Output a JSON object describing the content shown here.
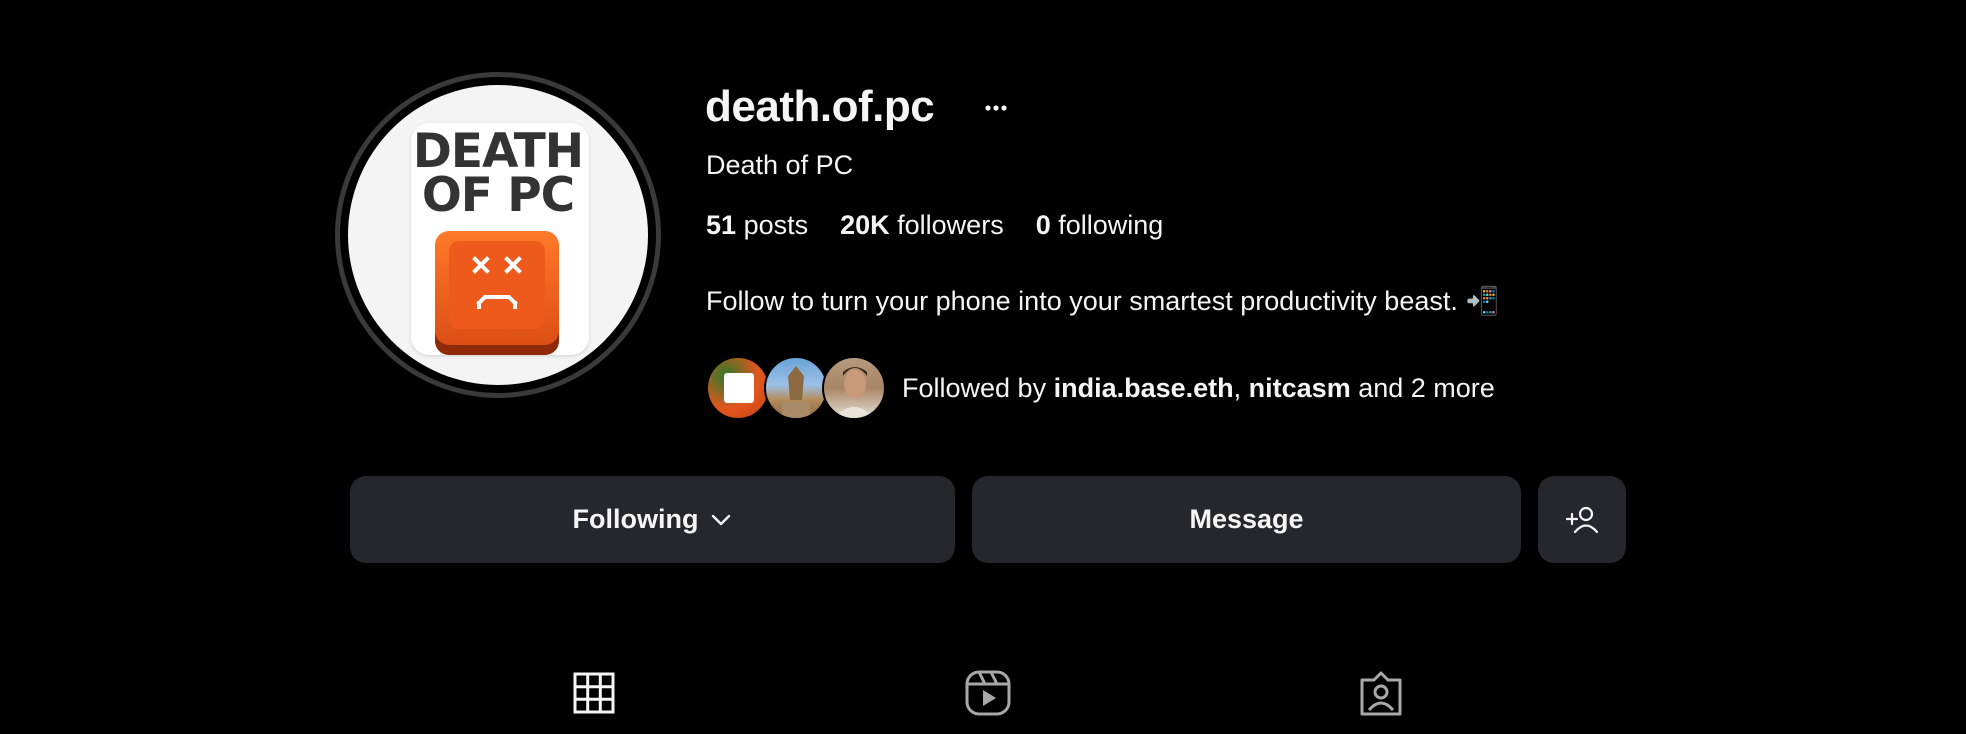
{
  "profile": {
    "username": "death.of.pc",
    "full_name": "Death of PC",
    "avatar_text": "DEATH OF PC",
    "stats": {
      "posts_count": "51",
      "posts_label": "posts",
      "followers_count": "20K",
      "followers_label": "followers",
      "following_count": "0",
      "following_label": "following"
    },
    "bio": "Follow to turn your phone into your smartest productivity beast.",
    "bio_emoji": "📲",
    "followed_by": {
      "prefix": "Followed by ",
      "user1": "india.base.eth",
      "separator": ", ",
      "user2": "nitcasm",
      "suffix": " and 2 more"
    }
  },
  "actions": {
    "following_label": "Following",
    "message_label": "Message",
    "add_user_icon": "add-user-icon"
  },
  "tabs": [
    {
      "name": "posts",
      "icon": "grid-icon"
    },
    {
      "name": "reels",
      "icon": "reels-icon"
    },
    {
      "name": "tagged",
      "icon": "tagged-icon"
    }
  ],
  "colors": {
    "background": "#000000",
    "button": "#25272c",
    "text": "#f5f5f5",
    "brand_orange": "#ee5a1c"
  }
}
